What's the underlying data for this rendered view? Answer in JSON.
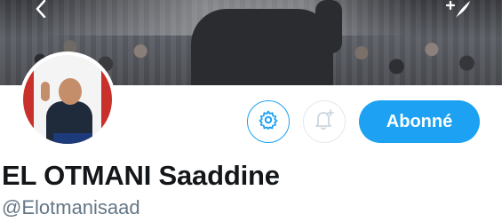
{
  "header": {
    "back_icon": "chevron-left-icon",
    "compose_icon": "compose-feather-icon"
  },
  "profile": {
    "display_name": "EL OTMANI Saaddine",
    "handle": "@Elotmanisaad"
  },
  "actions": {
    "settings_icon": "gear-icon",
    "notify_icon": "bell-plus-icon",
    "follow_label": "Abonné"
  },
  "colors": {
    "accent": "#1da1f2",
    "name": "#14171a",
    "handle": "#657786",
    "notify_border": "#e1e8ed"
  }
}
